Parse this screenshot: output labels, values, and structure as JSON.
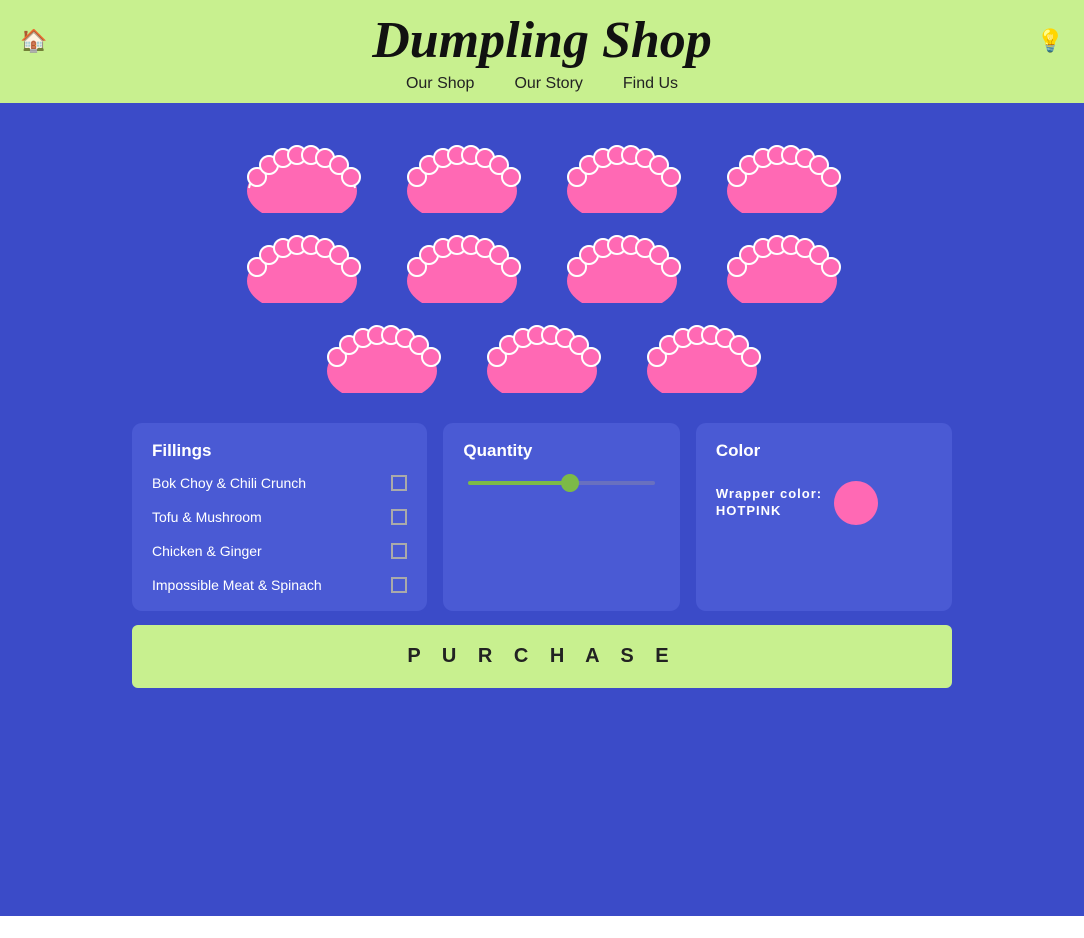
{
  "header": {
    "title": "Dumpling Shop",
    "nav": [
      {
        "label": "Our Shop",
        "href": "#"
      },
      {
        "label": "Our Story",
        "href": "#"
      },
      {
        "label": "Find Us",
        "href": "#"
      }
    ],
    "home_icon": "🏠",
    "settings_icon": "💡"
  },
  "dumplings": {
    "rows": [
      4,
      4,
      3
    ],
    "color": "hotpink"
  },
  "fillings": {
    "title": "Fillings",
    "items": [
      {
        "label": "Bok Choy & Chili Crunch",
        "checked": false
      },
      {
        "label": "Tofu & Mushroom",
        "checked": false
      },
      {
        "label": "Chicken & Ginger",
        "checked": false
      },
      {
        "label": "Impossible Meat & Spinach",
        "checked": false
      }
    ]
  },
  "quantity": {
    "title": "Quantity",
    "value": 55,
    "min": 0,
    "max": 100
  },
  "color": {
    "title": "Color",
    "wrapper_label": "Wrapper color:",
    "color_name": "HOTPINK",
    "hex": "#FF69B4"
  },
  "purchase": {
    "button_label": "P U R C H A S E"
  }
}
